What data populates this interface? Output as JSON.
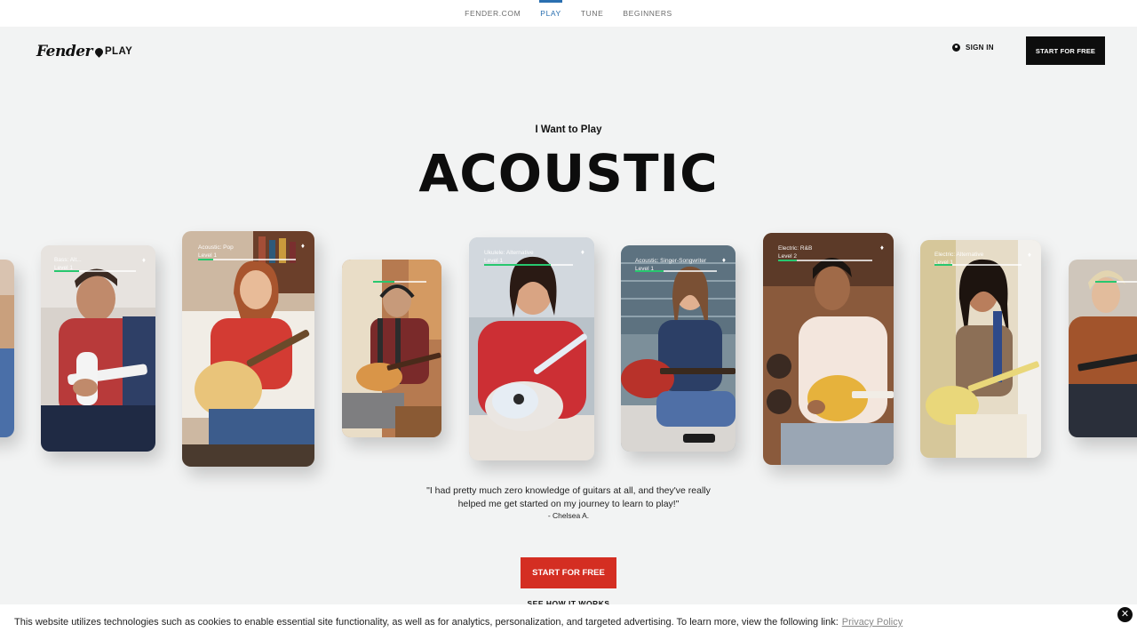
{
  "topnav": {
    "items": [
      {
        "label": "FENDER.COM",
        "active": false
      },
      {
        "label": "PLAY",
        "active": true
      },
      {
        "label": "TUNE",
        "active": false
      },
      {
        "label": "BEGINNERS",
        "active": false
      }
    ]
  },
  "header": {
    "logo_script": "Fender",
    "logo_play": "PLAY",
    "signin_label": "SIGN IN",
    "cta_label": "START FOR FREE"
  },
  "hero": {
    "eyebrow": "I Want to Play",
    "headline": "ACOUSTIC"
  },
  "cards": [
    {
      "tag_line1": "",
      "tag_line2": "",
      "progress": 0
    },
    {
      "tag_line1": "Bass: Alt...",
      "tag_line2": "Level 1",
      "progress": 0.3
    },
    {
      "tag_line1": "Acoustic: Pop",
      "tag_line2": "Level 1",
      "progress": 0.15
    },
    {
      "tag_line1": "",
      "tag_line2": "",
      "progress": 0.4
    },
    {
      "tag_line1": "Ukulele: Alternative",
      "tag_line2": "Level 1",
      "progress": 0.75
    },
    {
      "tag_line1": "Acoustic: Singer-Songwriter",
      "tag_line2": "Level 1",
      "progress": 0.35
    },
    {
      "tag_line1": "Electric: R&B",
      "tag_line2": "Level 2",
      "progress": 0.2
    },
    {
      "tag_line1": "Electric: Alternative",
      "tag_line2": "Level 1",
      "progress": 0.2
    },
    {
      "tag_line1": "",
      "tag_line2": "",
      "progress": 0.3
    }
  ],
  "testimonial": {
    "quote_line1": "\"I had pretty much zero knowledge of guitars at all, and they've really",
    "quote_line2": "helped me get started on my journey to learn to play!\"",
    "author": "- Chelsea A."
  },
  "cta": {
    "label": "START FOR FREE",
    "secondary_label": "SEE HOW IT WORKS"
  },
  "cookie": {
    "text": "This website utilizes technologies such as cookies to enable essential site functionality, as well as for analytics, personalization, and targeted advertising. To learn more, view the following link:",
    "link_label": "Privacy Policy",
    "close_glyph": "✕"
  },
  "colors": {
    "accent_red": "#d42e22",
    "nav_active": "#2a6fb0",
    "progress_green": "#28c76f"
  }
}
